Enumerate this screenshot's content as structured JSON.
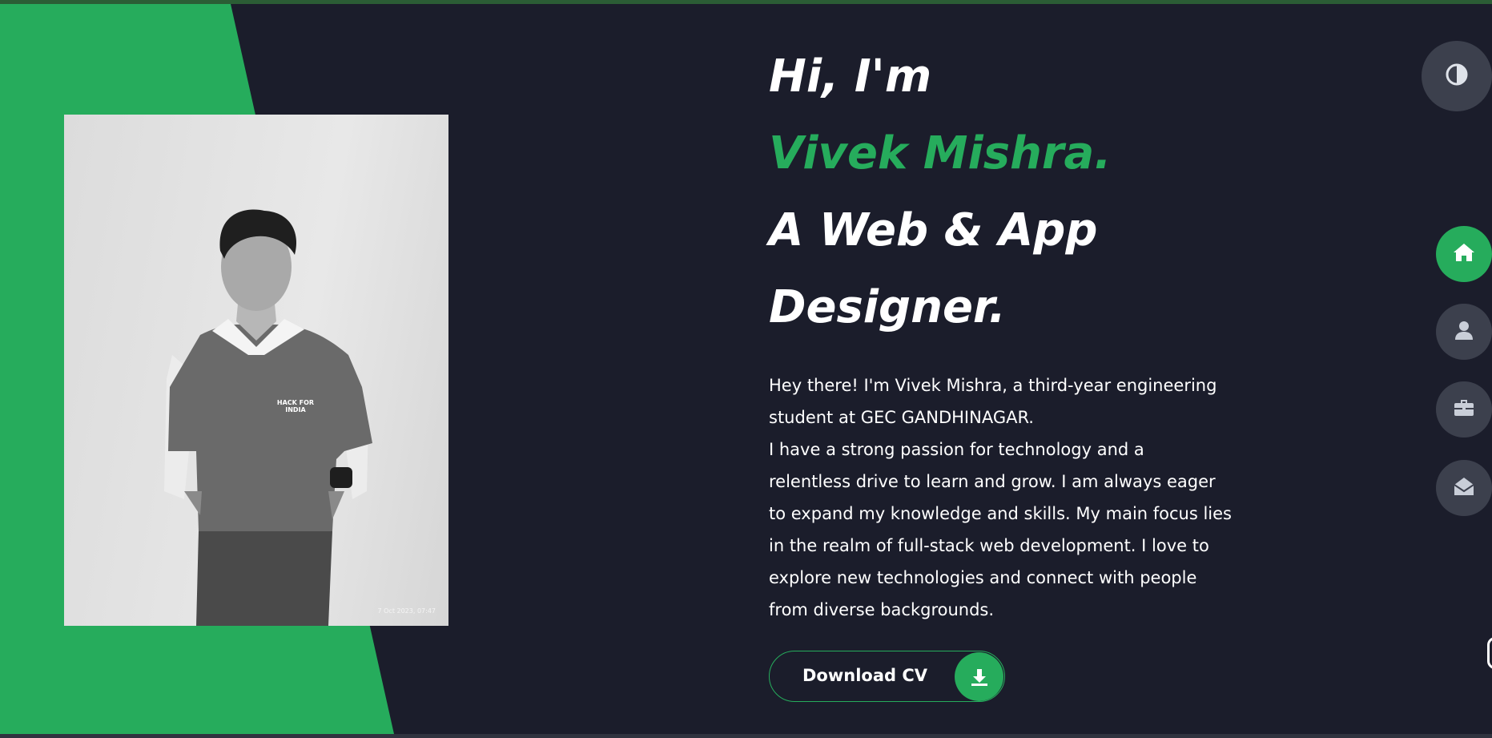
{
  "hero": {
    "greeting": "Hi, I'm",
    "name": "Vivek Mishra.",
    "role_line1": "A Web & App",
    "role_line2": "Designer.",
    "bio_line1": "Hey there! I'm Vivek Mishra, a third-year engineering",
    "bio_line2": "student at GEC GANDHINAGAR.",
    "bio_line3": "I have a strong passion for technology and a",
    "bio_line4": "relentless drive to learn and grow. I am always eager",
    "bio_line5": "to expand my knowledge and skills. My main focus lies",
    "bio_line6": "in the realm of full-stack web development. I love to",
    "bio_line7": "explore new technologies and connect with people",
    "bio_line8": "from diverse backgrounds."
  },
  "cv_button": {
    "label": "Download CV",
    "icon": "download-icon"
  },
  "photo": {
    "stamp": "7 Oct 2023, 07:47",
    "shirt_text": "HACK FOR INDIA"
  },
  "side_nav": {
    "theme_icon": "contrast-icon",
    "items": [
      {
        "name": "home",
        "icon": "home-icon",
        "active": true
      },
      {
        "name": "about",
        "icon": "user-icon",
        "active": false
      },
      {
        "name": "portfolio",
        "icon": "briefcase-icon",
        "active": false
      },
      {
        "name": "contact",
        "icon": "envelope-open-icon",
        "active": false
      }
    ]
  },
  "colors": {
    "background": "#1b1d2b",
    "accent": "#26ac5c",
    "nav_inactive": "#3c404d",
    "text": "#ffffff"
  }
}
